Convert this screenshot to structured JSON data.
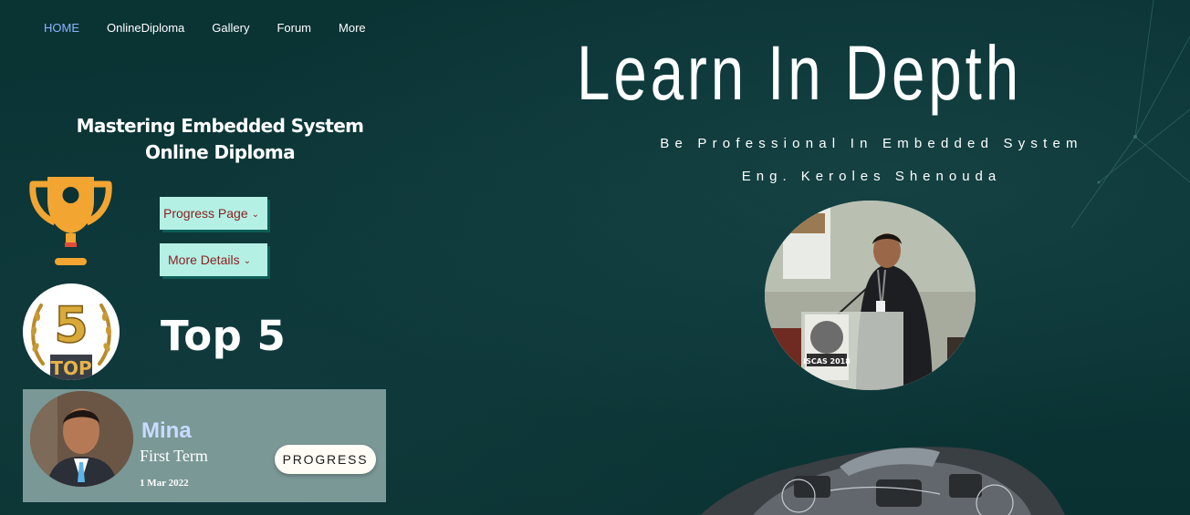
{
  "nav": {
    "items": [
      {
        "label": "HOME",
        "active": true
      },
      {
        "label": "OnlineDiploma",
        "active": false
      },
      {
        "label": "Gallery",
        "active": false
      },
      {
        "label": "Forum",
        "active": false
      },
      {
        "label": "More",
        "active": false
      }
    ]
  },
  "left": {
    "diploma_title_line1": "Mastering Embedded System",
    "diploma_title_line2": "Online Diploma",
    "progress_button": "Progress Page",
    "details_button": "More Details",
    "top_label": "Top 5",
    "badge_number": "5",
    "badge_text": "TOP"
  },
  "student_card": {
    "name": "Mina",
    "term": "First Term",
    "date": "1 Mar 2022",
    "button": "PROGRESS"
  },
  "hero": {
    "title": "Learn In Depth",
    "subtitle": "Be Professional In Embedded System",
    "author": "Eng. Keroles Shenouda"
  },
  "photo": {
    "podium_text": "ISCAS 2018"
  },
  "colors": {
    "background": "#0b3233",
    "button_bg": "#b4f0e4",
    "button_text": "#8a1f1f",
    "nav_active": "#8ab4ff",
    "card_bg": "#7a9896",
    "name_color": "#c9dcff",
    "trophy": "#f2a531"
  }
}
